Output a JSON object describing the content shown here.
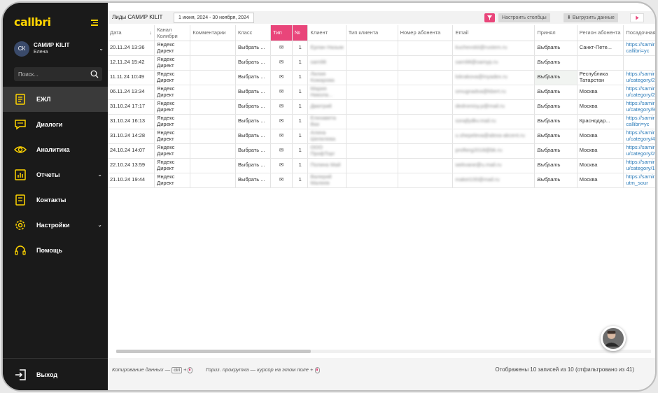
{
  "brand": {
    "logo": "callbri",
    "accent": "#ffd400",
    "pink": "#e9457a"
  },
  "user": {
    "initials": "СК",
    "name": "САМИР KILIT",
    "sub": "Елена"
  },
  "search": {
    "placeholder": "Поиск..."
  },
  "nav": [
    {
      "label": "ЕЖЛ",
      "icon": "journal-icon",
      "active": true
    },
    {
      "label": "Диалоги",
      "icon": "chat-icon"
    },
    {
      "label": "Аналитика",
      "icon": "eye-icon"
    },
    {
      "label": "Отчеты",
      "icon": "bar-chart-icon",
      "chevron": true
    },
    {
      "label": "Контакты",
      "icon": "contacts-icon"
    },
    {
      "label": "Настройки",
      "icon": "gear-icon",
      "chevron": true
    },
    {
      "label": "Помощь",
      "icon": "headset-icon"
    }
  ],
  "logout_label": "Выход",
  "topbar": {
    "title": "Лиды САМИР KILIT",
    "date_range": "1 июня, 2024 - 30 ноября, 2024",
    "columns_button": "Настроить столбцы",
    "export_button": "Выгрузить данные"
  },
  "table": {
    "headers": [
      "Дата",
      "Канал Колибри",
      "Комментарии",
      "Класс",
      "Тип",
      "№",
      "Клиент",
      "Тип клиента",
      "Номер абонента",
      "Email",
      "Принял",
      "Регион абонента",
      "Посадочная"
    ],
    "rows": [
      [
        "20.11.24 13:36",
        "Яндекс Директ",
        "",
        "Выбрать ...",
        "✉",
        "1",
        "Ерлан Назым",
        "",
        "",
        "kuchevskii@rustem.ru",
        "Выбрать",
        "Санкт-Пете...",
        "https://samir u/?callibri=yc"
      ],
      [
        "12.11.24 15:42",
        "Яндекс Директ",
        "",
        "Выбрать ...",
        "✉",
        "1",
        "sam98",
        "",
        "",
        "sam98@samyp.ru",
        "Выбрать",
        "",
        ""
      ],
      [
        "11.11.24 10:49",
        "Яндекс Директ",
        "",
        "Выбрать ...",
        "✉",
        "1",
        "Лилия Кожарова",
        "",
        "",
        "lokrakova@inyadex.ru",
        "Выбрать",
        "Республика Татарстан",
        "https://samir u/category/2"
      ],
      [
        "06.11.24 13:34",
        "Яндекс Директ",
        "",
        "Выбрать ...",
        "✉",
        "1",
        "Мария Никола...",
        "",
        "",
        "omugnadva@kbert.ru",
        "Выбрать",
        "Москва",
        "https://samir u/category/2"
      ],
      [
        "31.10.24 17:17",
        "Яндекс Директ",
        "",
        "Выбрать ...",
        "✉",
        "1",
        "Дмитрий",
        "",
        "",
        "dedromisy.p@mail.ru",
        "Выбрать",
        "Москва",
        "https://samir u/category/9"
      ],
      [
        "31.10.24 16:13",
        "Яндекс Директ",
        "",
        "Выбрать ...",
        "✉",
        "1",
        "Елизавета Вах",
        "",
        "",
        "sorajfydkv.mail.ru",
        "Выбрать",
        "Краснодар...",
        "https://samir u/?callibri=yc"
      ],
      [
        "31.10.24 14:28",
        "Яндекс Директ",
        "",
        "Выбрать ...",
        "✉",
        "1",
        "Алина Шепелева",
        "",
        "",
        "u.shepeleva@alexa-akcent.ru",
        "Выбрать",
        "Москва",
        "https://samir u/category/4"
      ],
      [
        "24.10.24 14:07",
        "Яндекс Директ",
        "",
        "Выбрать ...",
        "✉",
        "1",
        "ООО ПрофТорг",
        "",
        "",
        "profterg2018@bk.ru",
        "Выбрать",
        "Москва",
        "https://samir u/category/2"
      ],
      [
        "22.10.24 13:59",
        "Яндекс Директ",
        "",
        "Выбрать ...",
        "✉",
        "1",
        "Полина Май",
        "",
        "",
        "wekvane@u.mail.ru",
        "Выбрать",
        "Москва",
        "https://samir u/category/1"
      ],
      [
        "21.10.24 19:44",
        "Яндекс Директ",
        "",
        "Выбрать ...",
        "✉",
        "1",
        "Валерий Малеев",
        "",
        "",
        "maket100@mail.ru",
        "Выбрать",
        "Москва",
        "https://samir u/?utm_sour"
      ]
    ]
  },
  "footer": {
    "copy_hint": "Копирование данных —",
    "kbd_ctrl": "ctrl",
    "plus": "+",
    "scroll_hint": "Гориз. прокрутка — курсор на этом поле +",
    "count": "Отображены 10 записей из 10 (отфильтровано из 41)"
  }
}
